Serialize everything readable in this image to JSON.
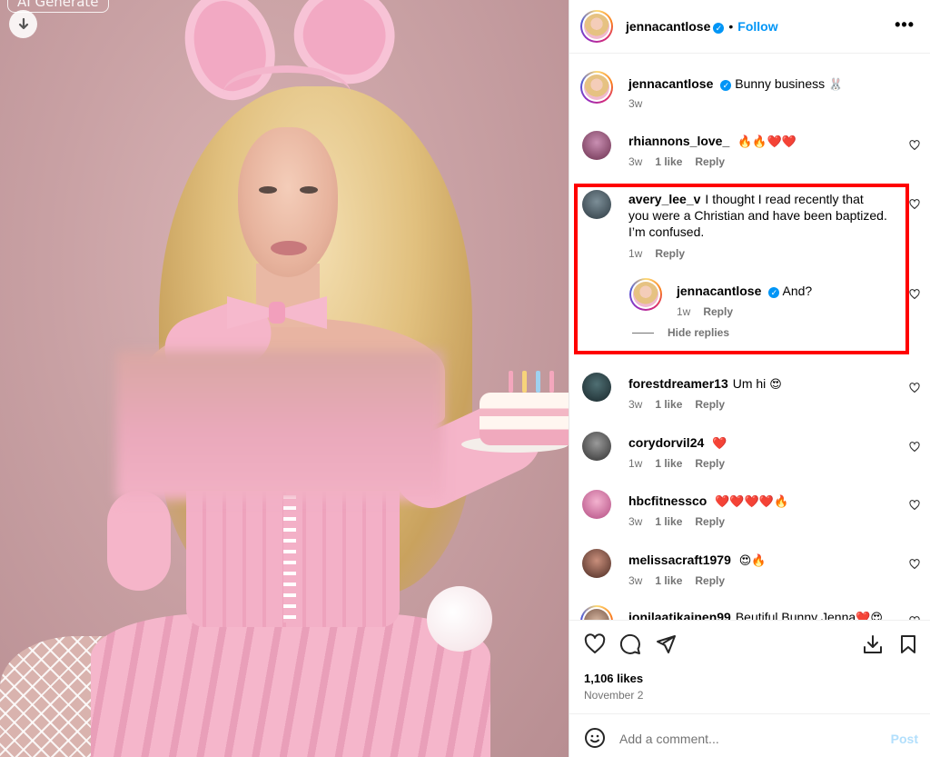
{
  "image_panel": {
    "ai_badge": "AI Generate",
    "download_icon": "download-arrow-icon"
  },
  "post": {
    "author": "jennacantlose",
    "follow_label": "Follow",
    "more_icon": "more-horizontal-icon",
    "caption_author": "jennacantlose",
    "caption_text": "Bunny business",
    "caption_emoji": "🐰",
    "caption_time": "3w"
  },
  "comments": [
    {
      "user": "rhiannons_love_",
      "text": "",
      "emoji": "🔥🔥❤️❤️",
      "time": "3w",
      "likes": "1 like",
      "reply": "Reply"
    },
    {
      "user": "avery_lee_v",
      "text": "I thought I read recently that you were a Christian and have been baptized. I’m confused.",
      "emoji": "",
      "time": "1w",
      "likes": "",
      "reply": "Reply"
    },
    {
      "user": "forestdreamer13",
      "text": "Um hi",
      "emoji": "😍",
      "time": "3w",
      "likes": "1 like",
      "reply": "Reply"
    },
    {
      "user": "corydorvil24",
      "text": "",
      "emoji": "❤️",
      "time": "1w",
      "likes": "1 like",
      "reply": "Reply"
    },
    {
      "user": "hbcfitnessco",
      "text": "",
      "emoji": "❤️❤️❤️❤️🔥",
      "time": "3w",
      "likes": "1 like",
      "reply": "Reply"
    },
    {
      "user": "melissacraft1979",
      "text": "",
      "emoji": "😍🔥",
      "time": "3w",
      "likes": "1 like",
      "reply": "Reply"
    },
    {
      "user": "jonilaatikainen99",
      "text": "Beutiful Bunny Jenna",
      "emoji": "❤️😍",
      "time": "",
      "likes": "",
      "reply": ""
    }
  ],
  "reply_thread": {
    "user": "jennacantlose",
    "text": "And?",
    "time": "1w",
    "reply": "Reply",
    "hide_replies": "Hide replies"
  },
  "actions": {
    "like_icon": "heart-icon",
    "comment_icon": "comment-icon",
    "share_icon": "send-icon",
    "download_icon": "download-icon",
    "save_icon": "bookmark-icon",
    "likes_count": "1,106 likes",
    "date": "November 2",
    "add_comment_placeholder": "Add a comment...",
    "post_label": "Post",
    "emoji_icon": "smiley-icon"
  },
  "colors": {
    "link_blue": "#0095f6",
    "highlight_red": "#ff0000",
    "post_disabled": "#b2dffc"
  }
}
